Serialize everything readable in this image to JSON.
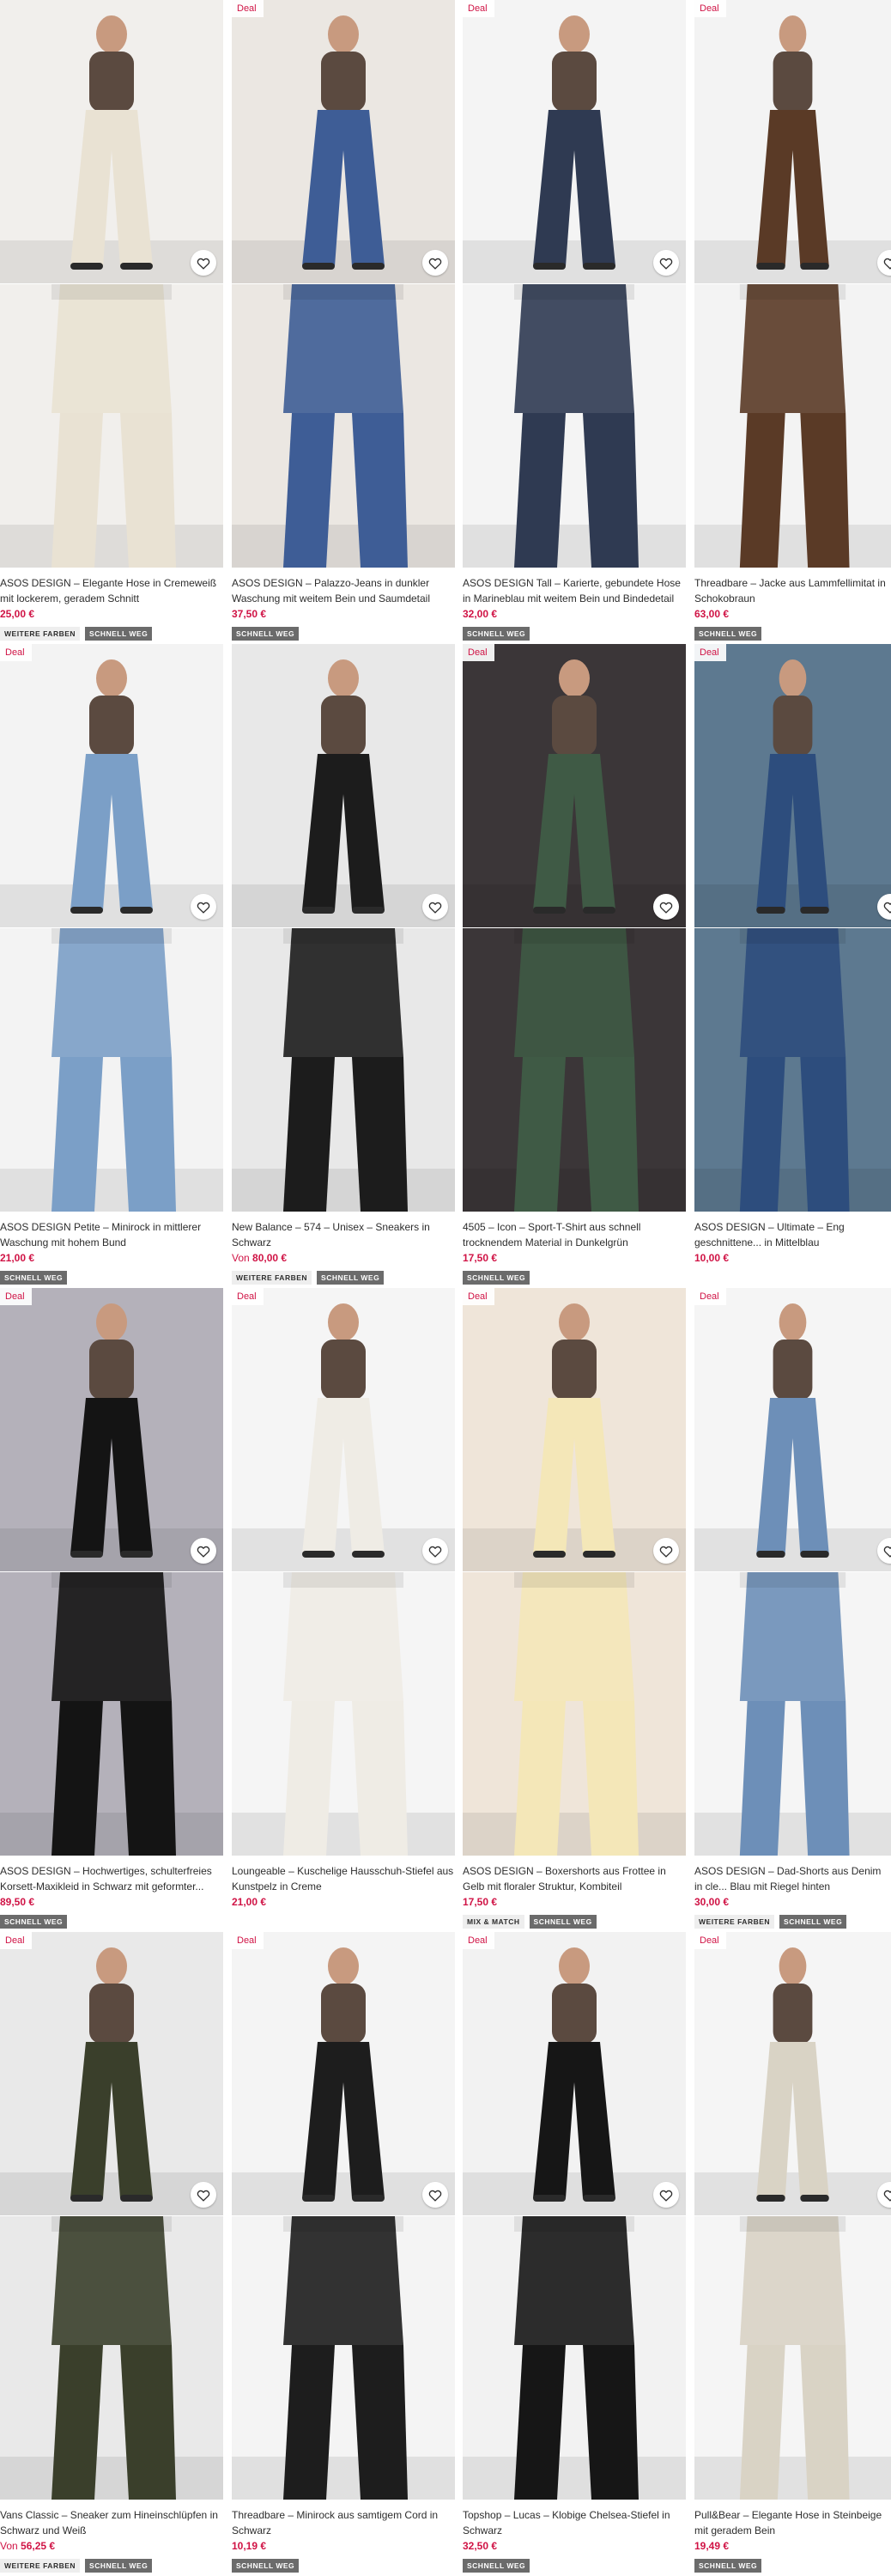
{
  "labels": {
    "deal": "Deal",
    "save_aria": "Speichern",
    "from_prefix": "Von"
  },
  "colors": {
    "price": "#d01345",
    "badge_dark": "#6b6b6b",
    "badge_light": "#eeeeee"
  },
  "products": [
    {
      "title": "ASOS DESIGN – Elegante Hose in Cremeweiß mit lockerem, geradem Schnitt",
      "price": "25,00 €",
      "has_from": false,
      "deal": false,
      "badges": [
        "WEITERE FARBEN",
        "SCHNELL WEG"
      ],
      "image_top": "model-cream-wide-trousers",
      "image_bottom": "cream-trousers-detail",
      "bg": "#f1efec",
      "tone": "#e9e2d3"
    },
    {
      "title": "ASOS DESIGN – Palazzo-Jeans in dunkler Waschung mit weitem Bein und Saumdetail",
      "price": "37,50 €",
      "has_from": false,
      "deal": true,
      "badges": [
        "SCHNELL WEG"
      ],
      "image_top": "model-red-top-blue-jeans",
      "image_bottom": "blue-jeans-side-view",
      "bg": "#ebe7e2",
      "tone": "#3e5d96"
    },
    {
      "title": "ASOS DESIGN Tall – Karierte, gebundete Hose in Marineblau mit weitem Bein und Bindedetail an de...",
      "price": "32,00 €",
      "has_from": false,
      "deal": true,
      "badges": [
        "SCHNELL WEG"
      ],
      "image_top": "model-plaid-trousers",
      "image_bottom": "plaid-fabric-closeup",
      "bg": "#f4f4f4",
      "tone": "#2f3a52"
    },
    {
      "title": "Threadbare – Jacke aus Lammfellimitat in Schokobraun",
      "price": "63,00 €",
      "has_from": false,
      "deal": true,
      "badges": [
        "SCHNELL WEG"
      ],
      "image_top": "model-brown-faux-fur-jacket",
      "image_bottom": "faux-fur-jacket-boots",
      "bg": "#f3f3f3",
      "tone": "#5a3a26"
    },
    {
      "title": "ASOS DESIGN Petite – Minirock in mittlerer Waschung mit hohem Bund",
      "price": "21,00 €",
      "has_from": false,
      "deal": true,
      "badges": [
        "SCHNELL WEG"
      ],
      "image_top": "model-pink-cardigan-denim-skirt",
      "image_bottom": "pink-cardigan-denim-skirt-front",
      "bg": "#f3f3f3",
      "tone": "#7b9fc7"
    },
    {
      "title": "New Balance – 574 – Unisex – Sneakers in Schwarz",
      "price": "80,00 €",
      "has_from": true,
      "deal": false,
      "badges": [
        "WEITERE FARBEN",
        "SCHNELL WEG"
      ],
      "image_top": "black-sneakers-on-feet",
      "image_bottom": "black-sneakers-walking",
      "bg": "#e8e8e8",
      "tone": "#1c1c1c"
    },
    {
      "title": "4505 – Icon – Sport-T-Shirt aus schnell trocknendem Material in Dunkelgrün",
      "price": "17,50 €",
      "has_from": false,
      "deal": true,
      "badges": [
        "SCHNELL WEG"
      ],
      "image_top": "model-dark-green-tshirt",
      "image_bottom": "green-tshirt-back-detail",
      "bg": "#3b3638",
      "tone": "#3f5a45"
    },
    {
      "title": "ASOS DESIGN – Ultimate – Eng geschnittene... in Mittelblau",
      "price": "10,00 €",
      "has_from": false,
      "deal": true,
      "badges": [],
      "image_top": "model-white-sweater-skinny-jeans",
      "image_bottom": "skinny-jeans-side",
      "bg": "#5d7990",
      "tone": "#2d4d7d"
    },
    {
      "title": "ASOS DESIGN – Hochwertiges, schulterfreies Korsett-Maxikleid in Schwarz mit geformter...",
      "price": "89,50 €",
      "has_from": false,
      "deal": true,
      "badges": [
        "SCHNELL WEG"
      ],
      "image_top": "model-black-maxi-dress",
      "image_bottom": "black-corset-maxi-dress",
      "bg": "#b4b1ba",
      "tone": "#141414"
    },
    {
      "title": "Loungeable – Kuschelige Hausschuh-Stiefel aus Kunstpelz in Creme",
      "price": "21,00 €",
      "has_from": false,
      "deal": true,
      "badges": [],
      "image_top": "cream-faux-fur-slipper-boots",
      "image_bottom": "faux-fur-slipper-closeup",
      "bg": "#f5f5f5",
      "tone": "#efece5"
    },
    {
      "title": "ASOS DESIGN – Boxershorts aus Frottee in Gelb mit floraler Struktur, Kombiteil",
      "price": "17,50 €",
      "has_from": false,
      "deal": true,
      "badges": [
        "MIX & MATCH",
        "SCHNELL WEG"
      ],
      "image_top": "model-yellow-terry-set",
      "image_bottom": "yellow-terry-shirt-shorts",
      "bg": "#efe5d9",
      "tone": "#f4e7b8"
    },
    {
      "title": "ASOS DESIGN – Dad-Shorts aus Denim in cle... Blau mit Riegel hinten",
      "price": "30,00 €",
      "has_from": false,
      "deal": true,
      "badges": [
        "WEITERE FARBEN",
        "SCHNELL WEG"
      ],
      "image_top": "model-denim-dad-shorts",
      "image_bottom": "denim-shorts-white-top",
      "bg": "#f5f5f5",
      "tone": "#6d8fb8"
    },
    {
      "title": "Vans Classic – Sneaker zum Hineinschlüpfen in Schwarz und Weiß",
      "price": "56,25 €",
      "has_from": true,
      "deal": true,
      "badges": [
        "WEITERE FARBEN",
        "SCHNELL WEG"
      ],
      "image_top": "checkerboard-slip-on-sneakers",
      "image_bottom": "model-camo-pants-checkerboard-floor",
      "bg": "#e9e9e9",
      "tone": "#3a3f2b"
    },
    {
      "title": "Threadbare – Minirock aus samtigem Cord in Schwarz",
      "price": "10,19 €",
      "has_from": false,
      "deal": true,
      "badges": [
        "SCHNELL WEG"
      ],
      "image_top": "model-black-cord-mini-skirt",
      "image_bottom": "cord-skirt-closeup",
      "bg": "#f4f4f4",
      "tone": "#1d1d1d"
    },
    {
      "title": "Topshop – Lucas – Klobige Chelsea-Stiefel in Schwarz",
      "price": "32,50 €",
      "has_from": false,
      "deal": true,
      "badges": [
        "SCHNELL WEG"
      ],
      "image_top": "black-chunky-chelsea-boots",
      "image_bottom": "chelsea-boots-with-jeans",
      "bg": "#f2f2f2",
      "tone": "#161616"
    },
    {
      "title": "Pull&Bear – Elegante Hose in Steinbeige mit geradem Bein",
      "price": "19,49 €",
      "has_from": false,
      "deal": true,
      "badges": [
        "SCHNELL WEG"
      ],
      "image_top": "model-stone-beige-trousers",
      "image_bottom": "beige-trousers-button-detail",
      "bg": "#f5f5f5",
      "tone": "#d9d3c5"
    }
  ]
}
